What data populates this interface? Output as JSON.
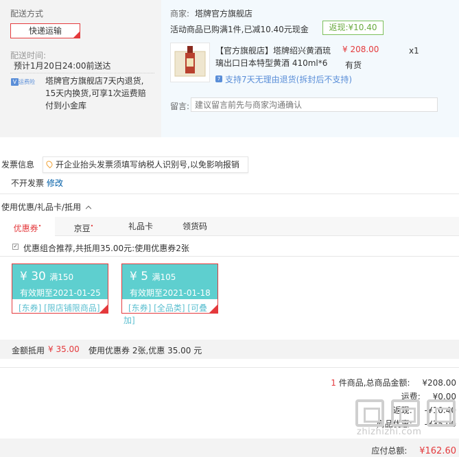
{
  "shipping": {
    "label": "配送方式",
    "method_button": "快递运输",
    "time_label": "配送时间:",
    "time_value": "预计1月20日24:00前送达",
    "insurance_icon_text": "运费险",
    "insurance_line1": "塔牌官方旗舰店7天内退货,",
    "insurance_line2": "15天内换货,可享1次运费赔",
    "insurance_line3": "付到小金库"
  },
  "shop": {
    "seller_label": "商家:",
    "seller_name": "塔牌官方旗舰店",
    "promo_text": "活动商品已购满1件,已减10.40元现金",
    "rebate_badge": "返现:¥10.40",
    "product_name_line1": "【官方旗舰店】塔牌绍兴黄酒琉",
    "product_name_line2": "璃出口日本特型黄酒 410ml*6",
    "product_price": "¥ 208.00",
    "product_qty": "x1",
    "stock_status": "有货",
    "refund_policy": "支持7天无理由退货(拆封后不支持)",
    "message_label": "留言:",
    "message_placeholder": "建议留言前先与商家沟通确认"
  },
  "invoice": {
    "label": "发票信息",
    "tip": "开企业抬头发票须填写纳税人识别号,以免影响报销",
    "value": "不开发票",
    "edit_link": "修改"
  },
  "discounts": {
    "header": "使用优惠/礼品卡/抵用",
    "tabs": [
      {
        "label": "优惠券",
        "dot": "•"
      },
      {
        "label": "京豆",
        "dot": "•"
      },
      {
        "label": "礼品卡",
        "dot": ""
      },
      {
        "label": "领货码",
        "dot": ""
      }
    ],
    "combo_text": "优惠组合推荐,共抵用35.00元:使用优惠券2张",
    "coupons": [
      {
        "symbol": "¥",
        "amount": "30",
        "condition": "满150",
        "valid": "有效期至2021-01-25",
        "tags": "[东券] [限店铺限商品]"
      },
      {
        "symbol": "¥",
        "amount": "5",
        "condition": "满105",
        "valid": "有效期至2021-01-18",
        "tags": "[东券] [全品类] [可叠",
        "tags2": "加]"
      }
    ],
    "sum_label": "金额抵用",
    "sum_value": "¥ 35.00",
    "sum_detail": "使用优惠券 2张,优惠 35.00 元"
  },
  "summary": {
    "item_count": "1",
    "items_label": "件商品,总商品金额:",
    "items_total": "¥208.00",
    "shipping_label": "运费:",
    "shipping_value": "¥0.00",
    "rebate_label": "返现:",
    "rebate_value": "-¥10.40",
    "coupon_label": "商品优惠:",
    "coupon_value": "-¥35.00",
    "payable_label": "应付总额:",
    "payable_value": "¥162.60"
  },
  "watermark": {
    "text": "zhizhizhi.com"
  },
  "colors": {
    "accent_red": "#e4393c",
    "link_blue": "#005ea7",
    "coupon_teal": "#5ecfcf",
    "rebate_green": "#6aaa3f"
  }
}
